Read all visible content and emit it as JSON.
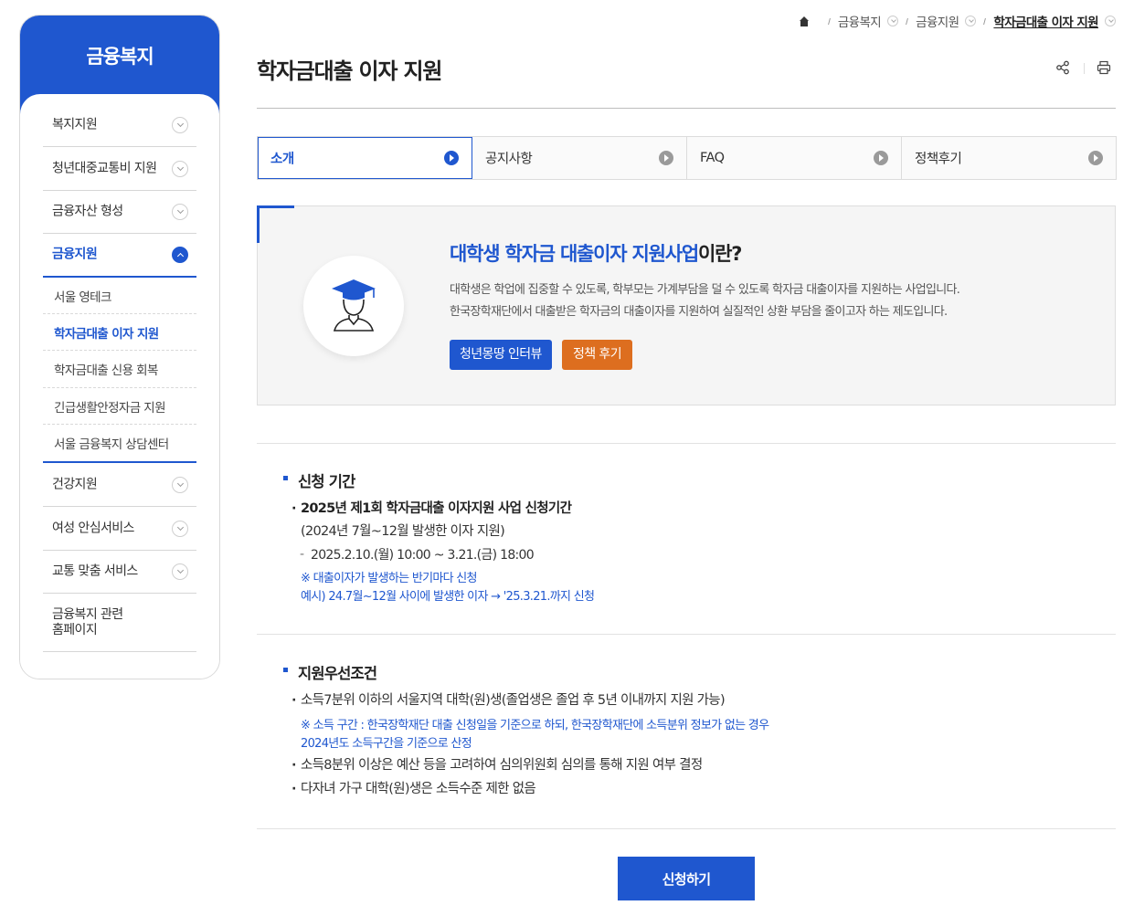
{
  "sidebar": {
    "title": "금융복지",
    "items": [
      {
        "label": "복지지원"
      },
      {
        "label": "청년대중교통비 지원"
      },
      {
        "label": "금융자산 형성"
      },
      {
        "label": "금융지원"
      },
      {
        "label": "건강지원"
      },
      {
        "label": "여성 안심서비스"
      },
      {
        "label": "교통 맞춤 서비스"
      },
      {
        "label": "금융복지 관련\n홈페이지"
      }
    ],
    "sub_items": [
      {
        "label": "서울 영테크"
      },
      {
        "label": "학자금대출 이자 지원"
      },
      {
        "label": "학자금대출 신용 회복"
      },
      {
        "label": "긴급생활안정자금 지원"
      },
      {
        "label": "서울 금융복지 상담센터"
      }
    ]
  },
  "breadcrumb": {
    "items": [
      {
        "label": "금융복지"
      },
      {
        "label": "금융지원"
      },
      {
        "label": "학자금대출 이자 지원"
      }
    ]
  },
  "page": {
    "title": "학자금대출 이자 지원"
  },
  "tabs": [
    {
      "label": "소개"
    },
    {
      "label": "공지사항"
    },
    {
      "label": "FAQ"
    },
    {
      "label": "정책후기"
    }
  ],
  "intro": {
    "heading_highlight": "대학생 학자금 대출이자 지원사업",
    "heading_rest": "이란?",
    "desc_line1": "대학생은 학업에 집중할 수 있도록, 학부모는 가계부담을 덜 수 있도록 학자금 대출이자를 지원하는 사업입니다.",
    "desc_line2": "한국장학재단에서 대출받은 학자금의 대출이자를 지원하여 실질적인 상환 부담을 줄이고자 하는 제도입니다.",
    "btn_interview": "청년몽땅 인터뷰",
    "btn_review": "정책 후기"
  },
  "section_period": {
    "title": "신청 기간",
    "line1": "2025년 제1회 학자금대출 이자지원 사업 신청기간",
    "line2": "(2024년 7월~12월 발생한 이자 지원)",
    "line3": "2025.2.10.(월) 10:00 ~ 3.21.(금) 18:00",
    "note1": "※ 대출이자가 발생하는 반기마다 신청",
    "note2": "예시) 24.7월~12월 사이에 발생한 이자 → '25.3.21.까지 신청"
  },
  "section_conditions": {
    "title": "지원우선조건",
    "line1": "소득7분위 이하의 서울지역 대학(원)생(졸업생은 졸업 후 5년 이내까지 지원 가능)",
    "note1": "※ 소득 구간 : 한국장학재단 대출 신청일을 기준으로 하되, 한국장학재단에 소득분위 정보가 없는 경우",
    "note2": "2024년도 소득구간을 기준으로 산정",
    "line2": "소득8분위 이상은 예산 등을 고려하여 심의위원회 심의를 통해 지원 여부 결정",
    "line3": "다자녀 가구 대학(원)생은 소득수준 제한 없음"
  },
  "apply_button": "신청하기",
  "colors": {
    "primary": "#1f57cf",
    "accent": "#dd6e1f"
  }
}
